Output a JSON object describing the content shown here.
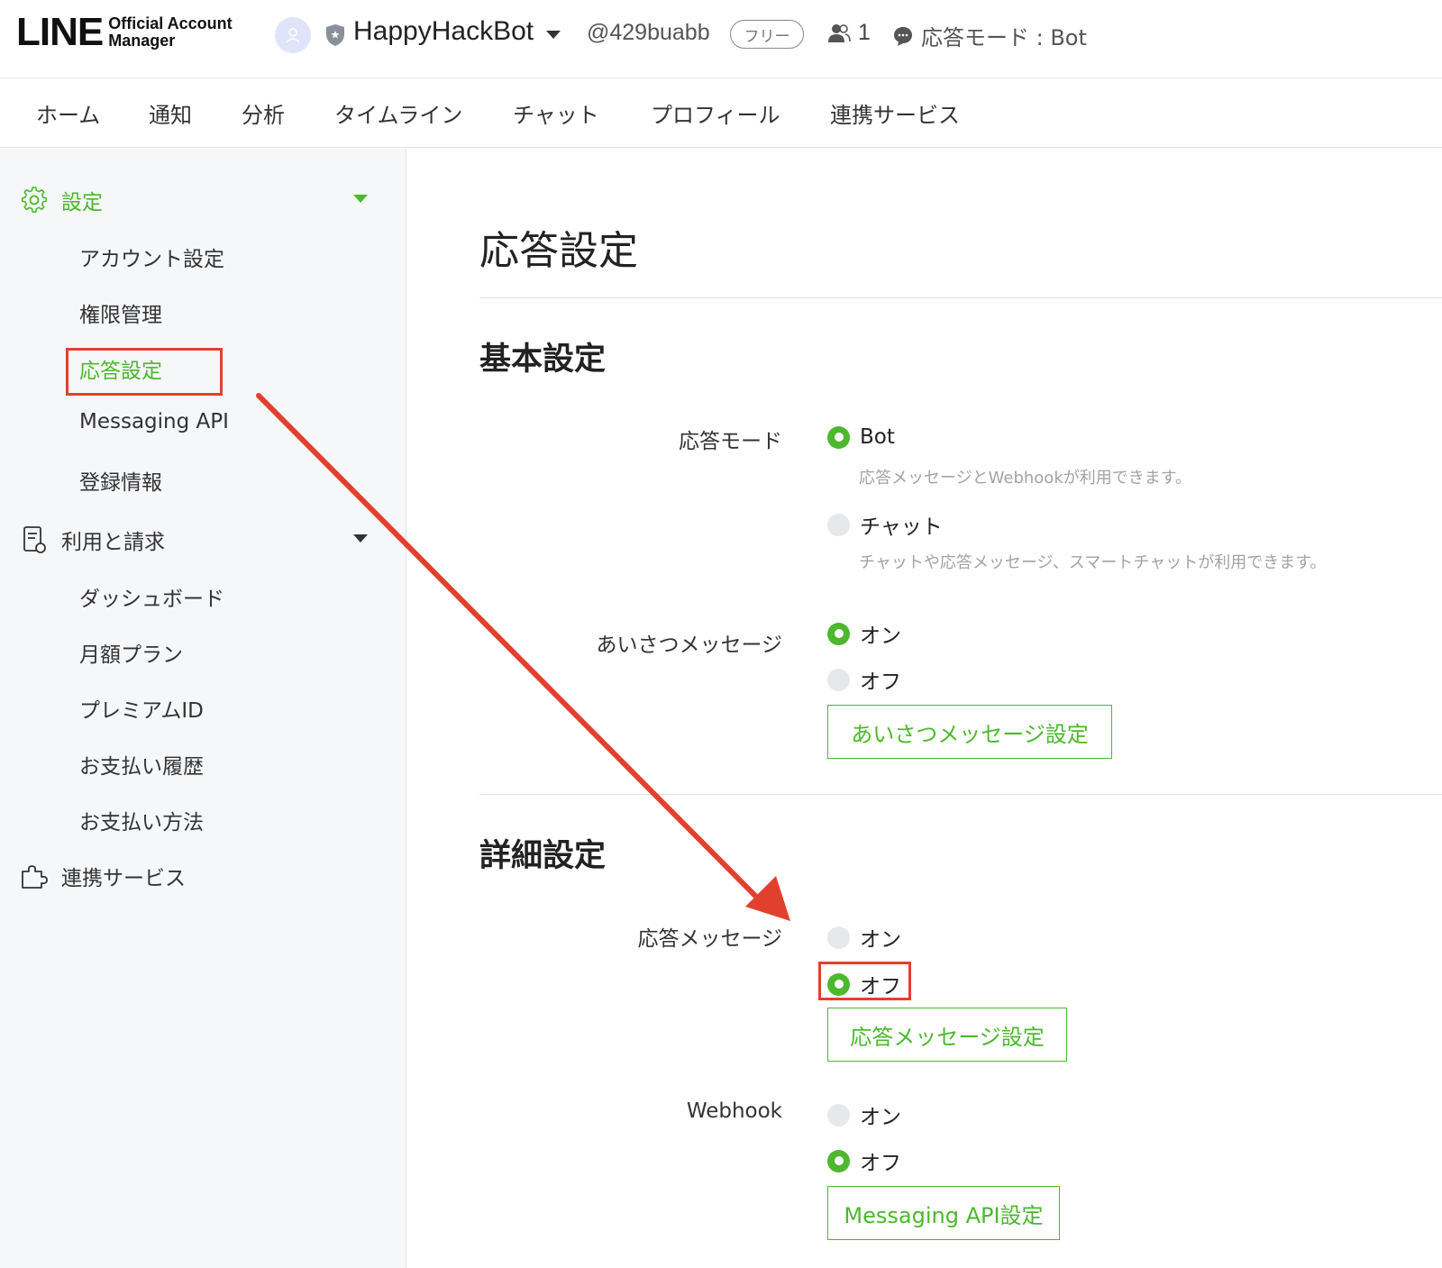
{
  "header": {
    "logo_main": "LINE",
    "logo_sub_line1": "Official Account",
    "logo_sub_line2": "Manager",
    "account_name": "HappyHackBot",
    "account_id": "@429buabb",
    "plan_badge": "フリー",
    "friend_count": "1",
    "response_mode": "応答モード : Bot"
  },
  "nav": {
    "items": [
      "ホーム",
      "通知",
      "分析",
      "タイムライン",
      "チャット",
      "プロフィール",
      "連携サービス"
    ]
  },
  "sidebar": {
    "settings_group": "設定",
    "settings_items": [
      "アカウント設定",
      "権限管理",
      "応答設定",
      "Messaging API",
      "登録情報"
    ],
    "billing_group": "利用と請求",
    "billing_items": [
      "ダッシュボード",
      "月額プラン",
      "プレミアムID",
      "お支払い履歴",
      "お支払い方法"
    ],
    "integration_group": "連携サービス"
  },
  "main": {
    "page_title": "応答設定",
    "basic_section": "基本設定",
    "response_mode": {
      "label": "応答モード",
      "opt_bot": "Bot",
      "opt_bot_desc": "応答メッセージとWebhookが利用できます。",
      "opt_chat": "チャット",
      "opt_chat_desc": "チャットや応答メッセージ、スマートチャットが利用できます。",
      "selected": "Bot"
    },
    "greeting": {
      "label": "あいさつメッセージ",
      "opt_on": "オン",
      "opt_off": "オフ",
      "selected": "オン",
      "button": "あいさつメッセージ設定"
    },
    "advanced_section": "詳細設定",
    "auto_reply": {
      "label": "応答メッセージ",
      "opt_on": "オン",
      "opt_off": "オフ",
      "selected": "オフ",
      "button": "応答メッセージ設定"
    },
    "webhook": {
      "label": "Webhook",
      "opt_on": "オン",
      "opt_off": "オフ",
      "selected": "オフ",
      "button": "Messaging API設定"
    }
  },
  "colors": {
    "accent_green": "#4cb82e",
    "annotation_red": "#e2402e"
  }
}
